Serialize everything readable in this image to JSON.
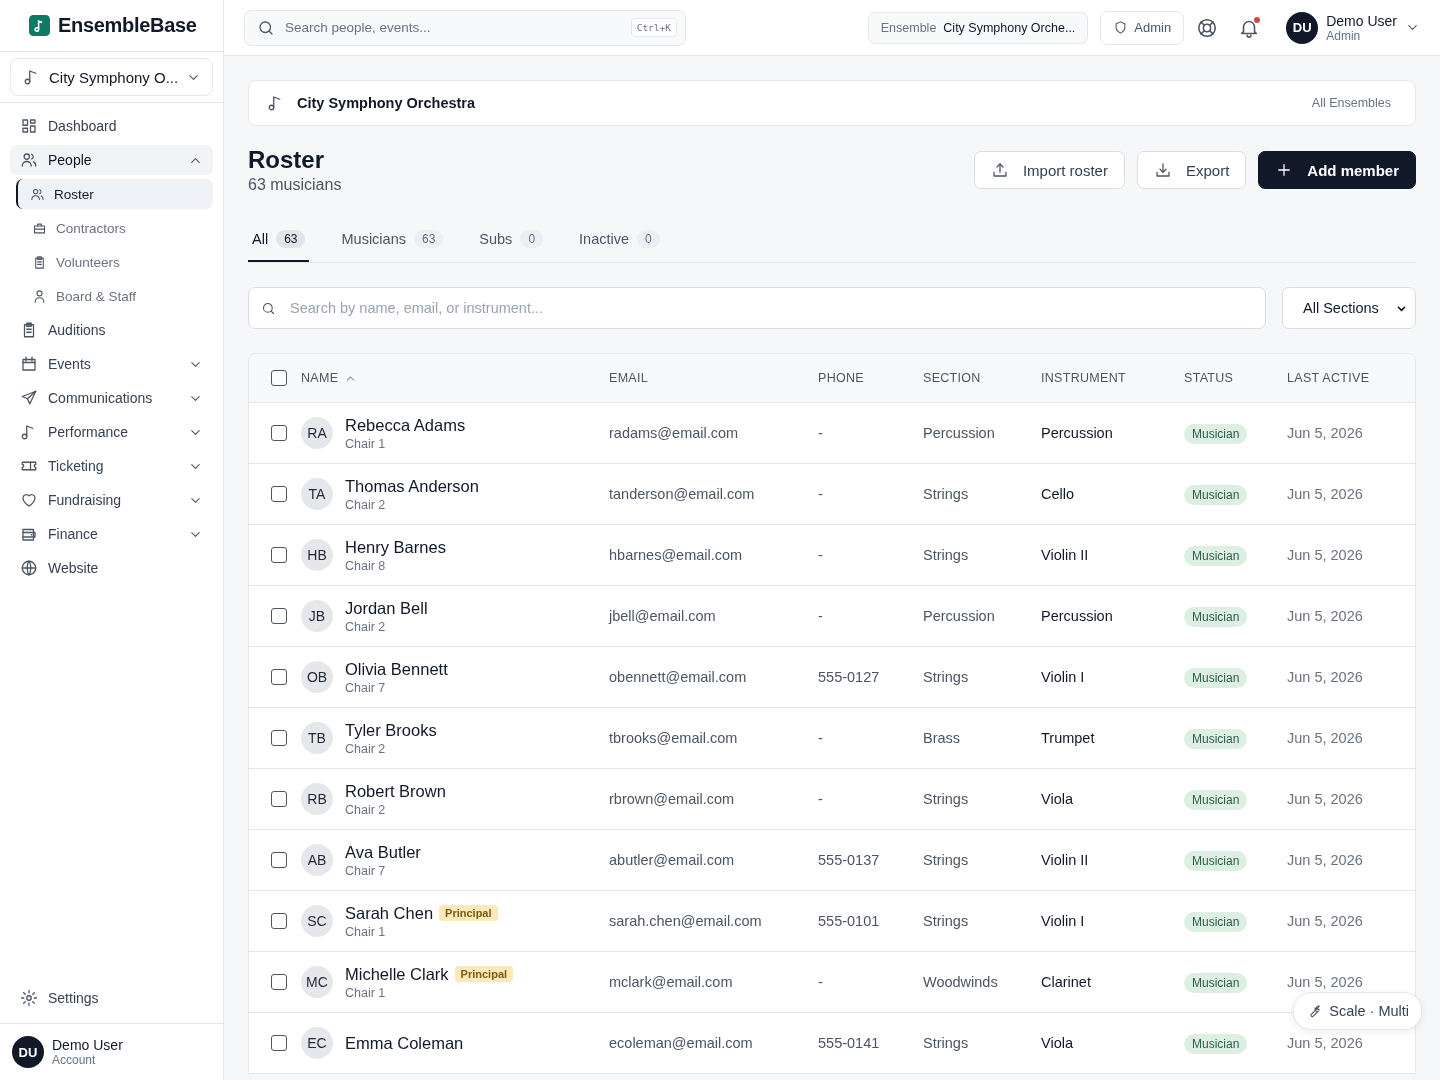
{
  "brand": {
    "name": "EnsembleBase"
  },
  "sidebar": {
    "ensemble_picker": {
      "value": "City Symphony O..."
    },
    "items": [
      {
        "label": "Dashboard",
        "selected": false
      },
      {
        "label": "People",
        "selected": true,
        "expanded": true,
        "children": [
          {
            "label": "Roster",
            "selected": true
          },
          {
            "label": "Contractors",
            "selected": false
          },
          {
            "label": "Volunteers",
            "selected": false
          },
          {
            "label": "Board & Staff",
            "selected": false
          }
        ]
      },
      {
        "label": "Auditions",
        "selected": false
      },
      {
        "label": "Events",
        "selected": false,
        "expanded": false
      },
      {
        "label": "Communications",
        "selected": false,
        "expanded": false
      },
      {
        "label": "Performance",
        "selected": false,
        "expanded": false
      },
      {
        "label": "Ticketing",
        "selected": false,
        "expanded": false
      },
      {
        "label": "Fundraising",
        "selected": false,
        "expanded": false
      },
      {
        "label": "Finance",
        "selected": false,
        "expanded": false
      },
      {
        "label": "Website",
        "selected": false
      }
    ],
    "settings": {
      "label": "Settings"
    },
    "account": {
      "initials": "DU",
      "name": "Demo User",
      "role": "Account"
    }
  },
  "topbar": {
    "search": {
      "placeholder": "Search people, events...",
      "shortcut": "Ctrl+K"
    },
    "ensemble_chip": {
      "label": "Ensemble",
      "value": "City Symphony Orche..."
    },
    "role_button": {
      "label": "Admin"
    },
    "notifications": {
      "unread": true
    },
    "user": {
      "initials": "DU",
      "name": "Demo User",
      "role": "Admin"
    }
  },
  "context_bar": {
    "title": "City Symphony Orchestra",
    "link": "All Ensembles"
  },
  "header": {
    "title": "Roster",
    "subtitle": "63 musicians",
    "buttons": [
      {
        "label": "Import roster",
        "kind": "upload"
      },
      {
        "label": "Export",
        "kind": "download"
      },
      {
        "label": "Add member",
        "kind": "add"
      }
    ]
  },
  "tabs": [
    {
      "label": "All",
      "count": "63",
      "selected": true
    },
    {
      "label": "Musicians",
      "count": "63",
      "selected": false
    },
    {
      "label": "Subs",
      "count": "0",
      "selected": false
    },
    {
      "label": "Inactive",
      "count": "0",
      "selected": false
    }
  ],
  "filters": {
    "search": {
      "placeholder": "Search by name, email, or instrument..."
    },
    "section_select": {
      "value": "All Sections"
    }
  },
  "table": {
    "select_all": {
      "checked": false
    },
    "columns": [
      {
        "label": "NAME",
        "sort_ascending": true
      },
      {
        "label": "EMAIL"
      },
      {
        "label": "PHONE"
      },
      {
        "label": "SECTION"
      },
      {
        "label": "INSTRUMENT"
      },
      {
        "label": "STATUS"
      },
      {
        "label": "LAST ACTIVE"
      }
    ],
    "rows": [
      {
        "checked": false,
        "initials": "RA",
        "name": "Rebecca Adams",
        "chair": "Chair 1",
        "email": "radams@email.com",
        "phone": "-",
        "section": "Percussion",
        "instrument": "Percussion",
        "status": "Musician",
        "last_active": "Jun 5, 2026"
      },
      {
        "checked": false,
        "initials": "TA",
        "name": "Thomas Anderson",
        "chair": "Chair 2",
        "email": "tanderson@email.com",
        "phone": "-",
        "section": "Strings",
        "instrument": "Cello",
        "status": "Musician",
        "last_active": "Jun 5, 2026"
      },
      {
        "checked": false,
        "initials": "HB",
        "name": "Henry Barnes",
        "chair": "Chair 8",
        "email": "hbarnes@email.com",
        "phone": "-",
        "section": "Strings",
        "instrument": "Violin II",
        "status": "Musician",
        "last_active": "Jun 5, 2026"
      },
      {
        "checked": false,
        "initials": "JB",
        "name": "Jordan Bell",
        "chair": "Chair 2",
        "email": "jbell@email.com",
        "phone": "-",
        "section": "Percussion",
        "instrument": "Percussion",
        "status": "Musician",
        "last_active": "Jun 5, 2026"
      },
      {
        "checked": false,
        "initials": "OB",
        "name": "Olivia Bennett",
        "chair": "Chair 7",
        "email": "obennett@email.com",
        "phone": "555-0127",
        "section": "Strings",
        "instrument": "Violin I",
        "status": "Musician",
        "last_active": "Jun 5, 2026"
      },
      {
        "checked": false,
        "initials": "TB",
        "name": "Tyler Brooks",
        "chair": "Chair 2",
        "email": "tbrooks@email.com",
        "phone": "-",
        "section": "Brass",
        "instrument": "Trumpet",
        "status": "Musician",
        "last_active": "Jun 5, 2026"
      },
      {
        "checked": false,
        "initials": "RB",
        "name": "Robert Brown",
        "chair": "Chair 2",
        "email": "rbrown@email.com",
        "phone": "-",
        "section": "Strings",
        "instrument": "Viola",
        "status": "Musician",
        "last_active": "Jun 5, 2026"
      },
      {
        "checked": false,
        "initials": "AB",
        "name": "Ava Butler",
        "chair": "Chair 7",
        "email": "abutler@email.com",
        "phone": "555-0137",
        "section": "Strings",
        "instrument": "Violin II",
        "status": "Musician",
        "last_active": "Jun 5, 2026"
      },
      {
        "checked": false,
        "initials": "SC",
        "name": "Sarah Chen",
        "badge": "Principal",
        "chair": "Chair 1",
        "email": "sarah.chen@email.com",
        "phone": "555-0101",
        "section": "Strings",
        "instrument": "Violin I",
        "status": "Musician",
        "last_active": "Jun 5, 2026"
      },
      {
        "checked": false,
        "initials": "MC",
        "name": "Michelle Clark",
        "badge": "Principal",
        "chair": "Chair 1",
        "email": "mclark@email.com",
        "phone": "-",
        "section": "Woodwinds",
        "instrument": "Clarinet",
        "status": "Musician",
        "last_active": "Jun 5, 2026"
      },
      {
        "checked": false,
        "initials": "EC",
        "name": "Emma Coleman",
        "email": "ecoleman@email.com",
        "phone": "555-0141",
        "section": "Strings",
        "instrument": "Viola",
        "status": "Musician",
        "last_active": "Jun 5, 2026"
      }
    ]
  },
  "floating_pill": {
    "label": "Scale · Multi"
  }
}
